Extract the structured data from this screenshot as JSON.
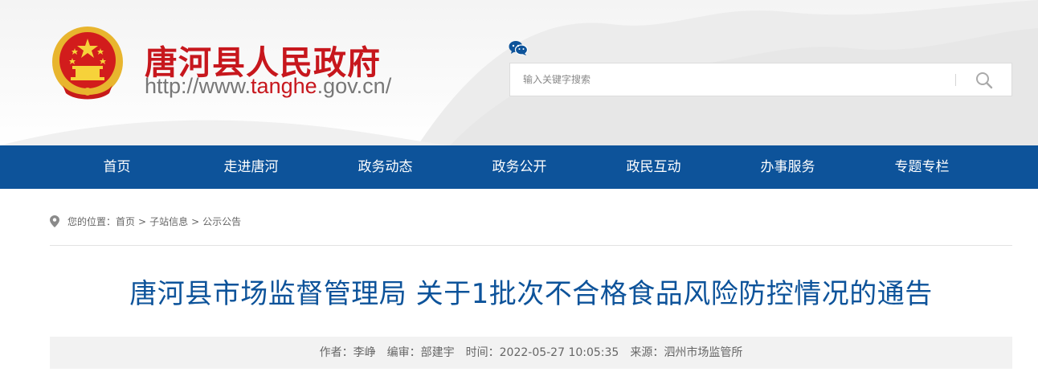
{
  "header": {
    "site_title": "唐河县人民政府",
    "url_prefix": "http://www.",
    "url_highlight": "tanghe",
    "url_suffix": ".gov.cn/",
    "wechat_icon": "wechat-icon",
    "emblem_icon": "national-emblem-icon",
    "search": {
      "placeholder": "输入关键字搜索",
      "value": "",
      "button_icon": "search-icon"
    }
  },
  "nav": {
    "items": [
      "首页",
      "走进唐河",
      "政务动态",
      "政务公开",
      "政民互动",
      "办事服务",
      "专题专栏"
    ]
  },
  "breadcrumb": {
    "icon": "location-pin-icon",
    "label": "您的位置：",
    "items": [
      "首页",
      "子站信息",
      "公示公告"
    ],
    "separator": ">"
  },
  "article": {
    "title": "唐河县市场监督管理局 关于1批次不合格食品风险防控情况的通告",
    "meta": {
      "author": "作者：李峥",
      "editor": "编审：部建宇",
      "time": "时间：2022-05-27 10:05:35",
      "source": "来源：泗州市场监管所"
    }
  },
  "colors": {
    "brand_red": "#c7171d",
    "nav_blue": "#0d539a",
    "title_blue": "#0d539a"
  }
}
